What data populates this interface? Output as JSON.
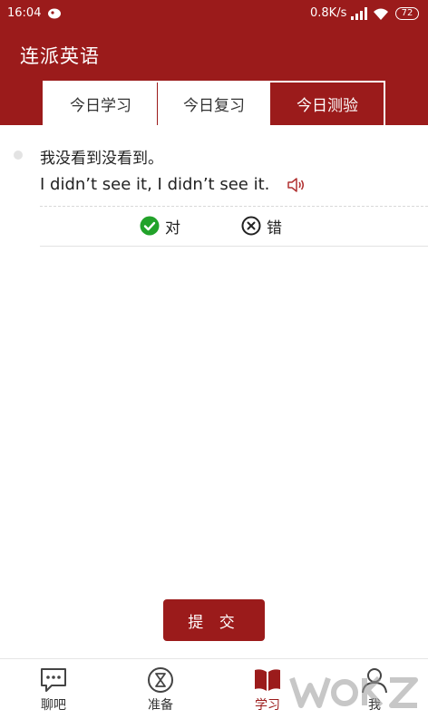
{
  "status_bar": {
    "time": "16:04",
    "network_speed": "0.8K/s",
    "battery": "72",
    "icons": [
      "notification-icon",
      "signal-icon",
      "wifi-icon",
      "battery-icon"
    ]
  },
  "header": {
    "title": "连派英语",
    "tabs": [
      {
        "label": "今日学习",
        "active": false
      },
      {
        "label": "今日复习",
        "active": false
      },
      {
        "label": "今日测验",
        "active": true
      }
    ]
  },
  "question": {
    "chinese": "我没看到没看到。",
    "english": "I didn’t see it, I didn’t see it.",
    "options": {
      "right": "对",
      "wrong": "错"
    }
  },
  "submit_label": "提 交",
  "bottom_nav": [
    {
      "label": "聊吧",
      "icon": "chat-icon",
      "active": false
    },
    {
      "label": "准备",
      "icon": "hourglass-icon",
      "active": false
    },
    {
      "label": "学习",
      "icon": "book-icon",
      "active": true
    },
    {
      "label": "我",
      "icon": "user-icon",
      "active": false
    }
  ],
  "colors": {
    "primary": "#9b1b1b",
    "correct": "#22a22a"
  }
}
